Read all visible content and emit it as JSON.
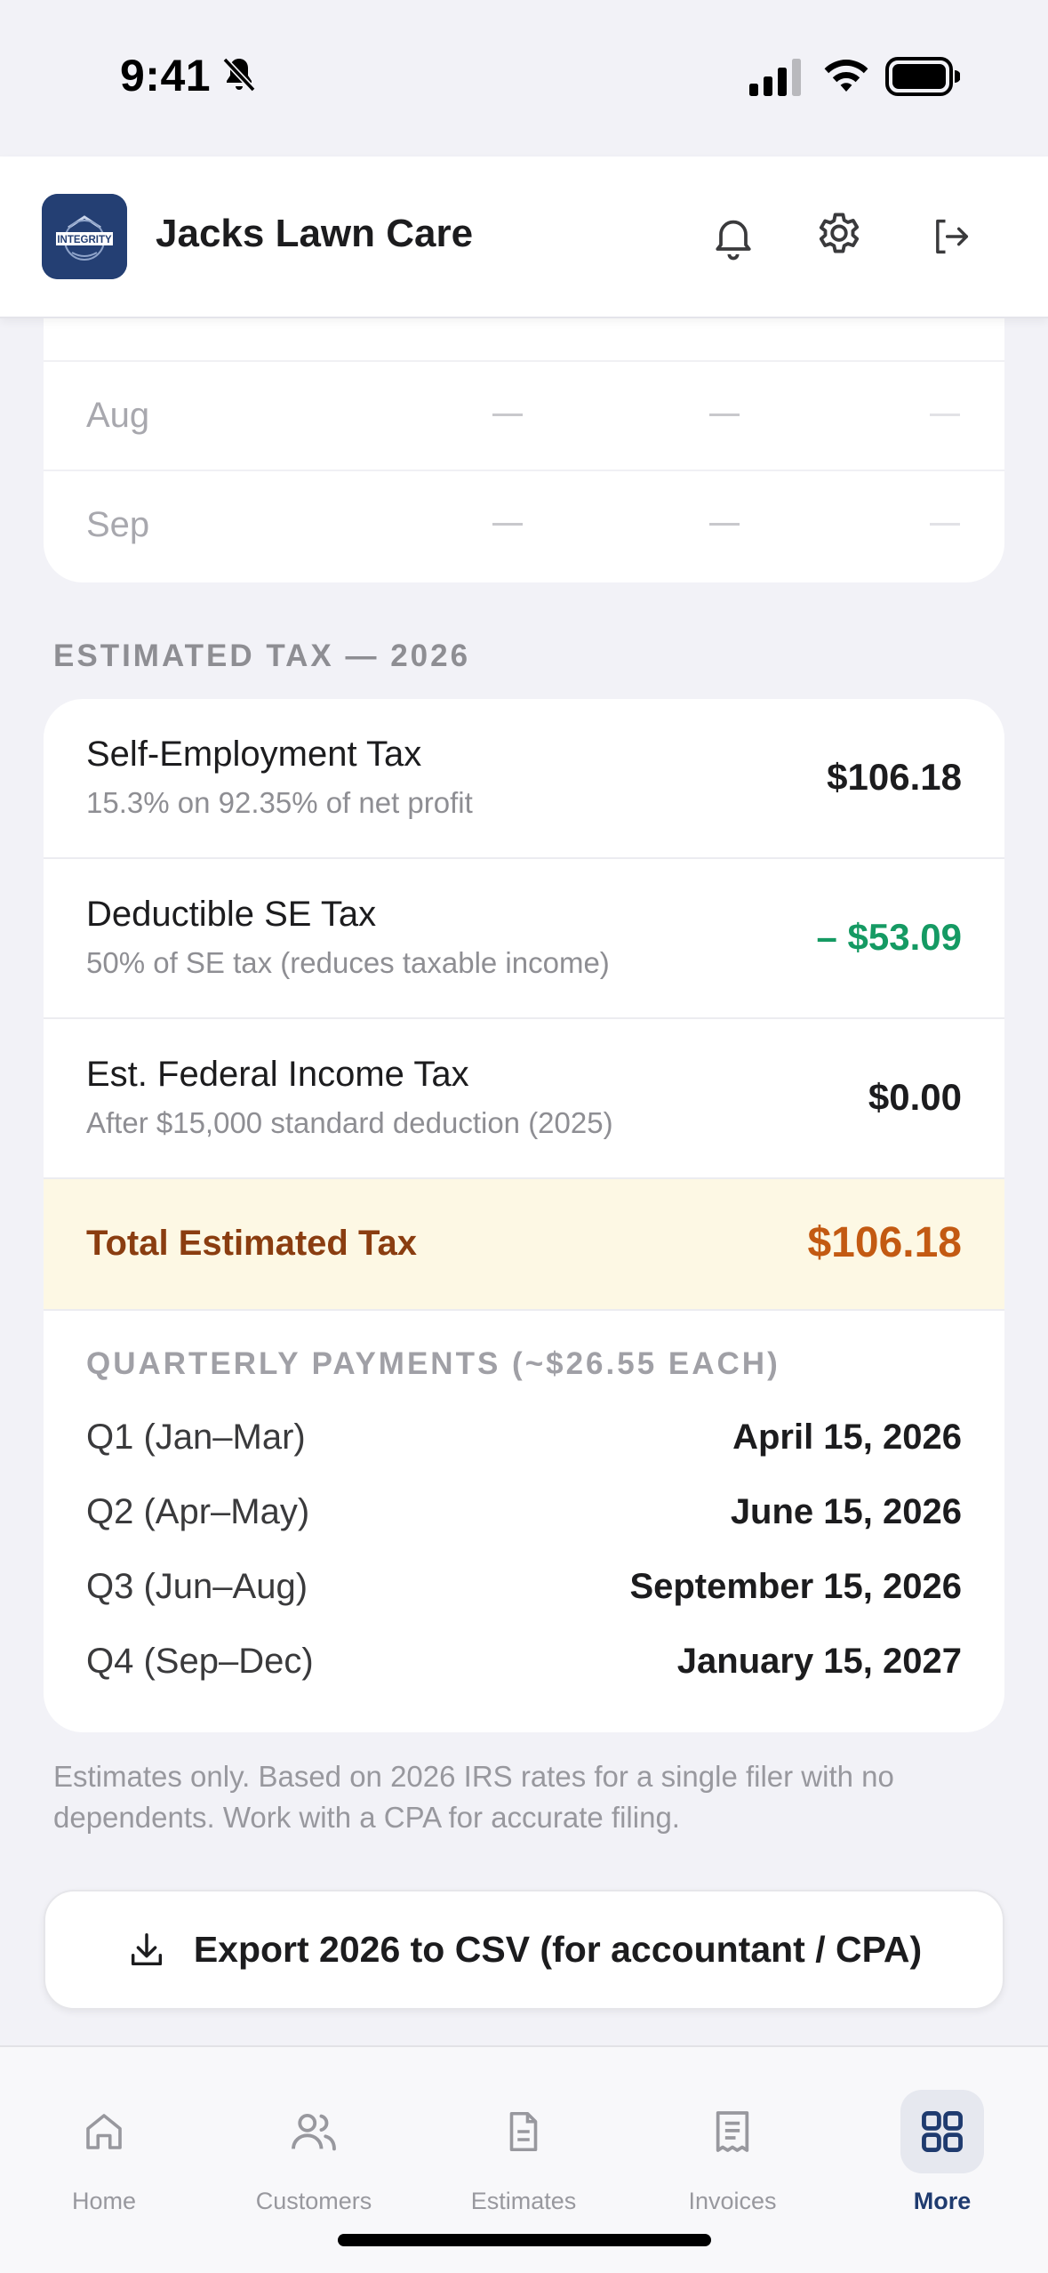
{
  "status_bar": {
    "time": "9:41"
  },
  "header": {
    "logo_text": "INTEGRITY",
    "business_name": "Jacks Lawn Care",
    "icons": [
      "bell-icon",
      "gear-icon",
      "logout-icon"
    ]
  },
  "monthly_table": {
    "rows": [
      {
        "month": "Aug",
        "values": [
          "—",
          "—",
          "—"
        ]
      },
      {
        "month": "Sep",
        "values": [
          "—",
          "—",
          "—"
        ]
      }
    ]
  },
  "estimated_tax": {
    "section_title": "ESTIMATED TAX — 2026",
    "rows": [
      {
        "title": "Self-Employment Tax",
        "subtitle": "15.3% on 92.35% of net profit",
        "value": "$106.18"
      },
      {
        "title": "Deductible SE Tax",
        "subtitle": "50% of SE tax (reduces taxable income)",
        "value": "– $53.09"
      },
      {
        "title": "Est. Federal Income Tax",
        "subtitle": "After $15,000 standard deduction (2025)",
        "value": "$0.00"
      }
    ],
    "total_label": "Total Estimated Tax",
    "total_value": "$106.18",
    "quarterly_title": "QUARTERLY PAYMENTS (~$26.55 EACH)",
    "quarters": [
      {
        "name": "Q1 (Jan–Mar)",
        "due": "April 15, 2026"
      },
      {
        "name": "Q2 (Apr–May)",
        "due": "June 15, 2026"
      },
      {
        "name": "Q3 (Jun–Aug)",
        "due": "September 15, 2026"
      },
      {
        "name": "Q4 (Sep–Dec)",
        "due": "January 15, 2027"
      }
    ]
  },
  "disclaimer": "Estimates only. Based on 2026 IRS rates for a single filer with no dependents. Work with a CPA for accurate filing.",
  "export_button": {
    "label": "Export 2026 to CSV (for accountant / CPA)",
    "icon": "download-icon"
  },
  "tab_bar": {
    "tabs": [
      {
        "label": "Home",
        "icon": "home-icon"
      },
      {
        "label": "Customers",
        "icon": "users-icon"
      },
      {
        "label": "Estimates",
        "icon": "document-icon"
      },
      {
        "label": "Invoices",
        "icon": "receipt-icon"
      },
      {
        "label": "More",
        "icon": "grid-icon",
        "active": true
      }
    ]
  },
  "colors": {
    "accent_navy": "#1f3b6f",
    "positive_green": "#159a63",
    "total_text": "#8a3d10",
    "total_value": "#c35a12",
    "total_background": "#fdf8e4"
  }
}
